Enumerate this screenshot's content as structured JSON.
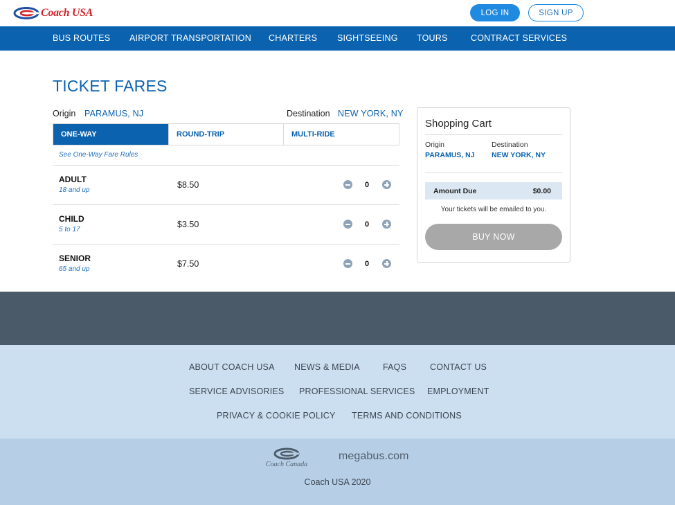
{
  "header": {
    "brand": "Coach USA",
    "login_label": "LOG IN",
    "signup_label": "SIGN UP"
  },
  "nav": {
    "items": [
      "BUS ROUTES",
      "AIRPORT TRANSPORTATION",
      "CHARTERS",
      "SIGHTSEEING",
      "TOURS",
      "CONTRACT SERVICES"
    ]
  },
  "main": {
    "title": "TICKET FARES",
    "origin_label": "Origin",
    "origin_value": "PARAMUS, NJ",
    "destination_label": "Destination",
    "destination_value": "NEW YORK, NY",
    "tabs": [
      {
        "label": "ONE-WAY",
        "active": true
      },
      {
        "label": "ROUND-TRIP",
        "active": false
      },
      {
        "label": "MULTI-RIDE",
        "active": false
      }
    ],
    "fare_rules_link": "See One-Way Fare Rules",
    "fares": [
      {
        "name": "ADULT",
        "sub": "18 and up",
        "price": "$8.50",
        "qty": "0"
      },
      {
        "name": "CHILD",
        "sub": "5 to 17",
        "price": "$3.50",
        "qty": "0"
      },
      {
        "name": "SENIOR",
        "sub": "65 and up",
        "price": "$7.50",
        "qty": "0"
      }
    ]
  },
  "cart": {
    "title": "Shopping Cart",
    "origin_label": "Origin",
    "origin_value": "PARAMUS, NJ",
    "destination_label": "Destination",
    "destination_value": "NEW YORK, NY",
    "amount_label": "Amount Due",
    "amount_value": "$0.00",
    "note": "Your tickets will be emailed to you.",
    "buy_label": "BUY NOW"
  },
  "footer": {
    "links": [
      "ABOUT COACH USA",
      "NEWS & MEDIA",
      "FAQS",
      "CONTACT US",
      "SERVICE ADVISORIES",
      "PROFESSIONAL SERVICES",
      "EMPLOYMENT",
      "PRIVACY & COOKIE POLICY",
      "TERMS AND CONDITIONS"
    ],
    "partner_coach_canada": "Coach Canada",
    "partner_megabus": "megabus.com",
    "copyright": "Coach USA 2020"
  },
  "colors": {
    "brand_blue": "#0b63b0",
    "brand_red": "#d3232a",
    "login_blue": "#1f8ae0",
    "footer_dark": "#4b5a69",
    "footer_light": "#ccdff0",
    "footer_bottom": "#b7cfe6"
  }
}
